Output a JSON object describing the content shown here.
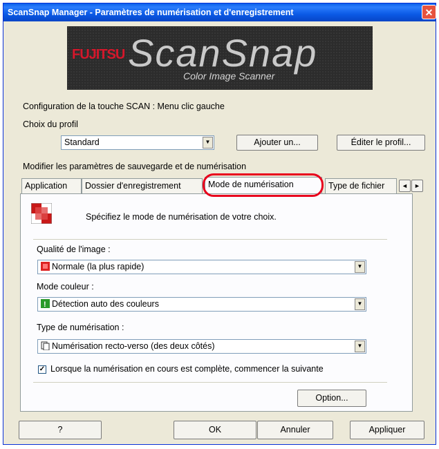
{
  "window": {
    "title": "ScanSnap Manager - Paramètres de numérisation et d'enregistrement",
    "close": "✕"
  },
  "banner": {
    "brand": "FUJITSU",
    "product": "ScanSnap",
    "tagline": "Color Image Scanner"
  },
  "config_line": "Configuration de la touche SCAN : Menu clic gauche",
  "profile": {
    "label": "Choix du profil",
    "selected": "Standard",
    "add_button": "Ajouter un...",
    "edit_button": "Éditer le profil..."
  },
  "settings_heading": "Modifier les paramètres de sauvegarde et de numérisation",
  "tabs": [
    {
      "label": "Application"
    },
    {
      "label": "Dossier d'enregistrement"
    },
    {
      "label": "Mode de numérisation",
      "active": true
    },
    {
      "label": "Type de fichier"
    }
  ],
  "tab_scroll": {
    "left": "◄",
    "right": "►"
  },
  "panel": {
    "description": "Spécifiez le mode de numérisation de votre choix.",
    "image_quality": {
      "label": "Qualité de l'image :",
      "value": "Normale (la plus rapide)"
    },
    "color_mode": {
      "label": "Mode couleur :",
      "value": "Détection auto des couleurs"
    },
    "scan_type": {
      "label": "Type de numérisation :",
      "value": "Numérisation recto-verso (des deux côtés)"
    },
    "continue_checkbox": {
      "label": "Lorsque la numérisation en cours est complète, commencer la suivante",
      "checked": true
    },
    "option_button": "Option..."
  },
  "footer": {
    "help": "?",
    "ok": "OK",
    "cancel": "Annuler",
    "apply": "Appliquer"
  },
  "colors": {
    "title_bar": "#0a5fe8",
    "highlight_ring": "#e8001c",
    "dialog_bg": "#ece9d8"
  }
}
